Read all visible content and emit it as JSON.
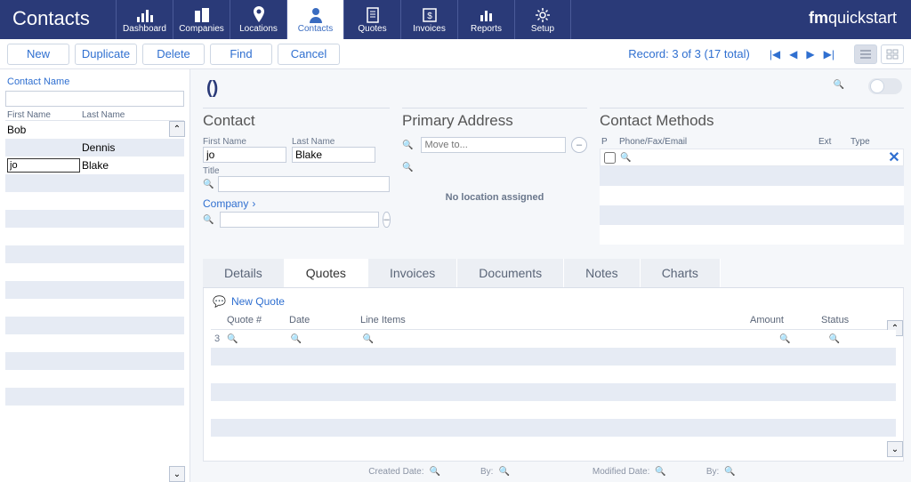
{
  "app": {
    "title": "Contacts"
  },
  "brand": {
    "bold": "fm",
    "light": "quickstart"
  },
  "nav": [
    {
      "id": "dashboard",
      "label": "Dashboard",
      "active": false
    },
    {
      "id": "companies",
      "label": "Companies",
      "active": false
    },
    {
      "id": "locations",
      "label": "Locations",
      "active": false
    },
    {
      "id": "contacts",
      "label": "Contacts",
      "active": true
    },
    {
      "id": "quotes",
      "label": "Quotes",
      "active": false
    },
    {
      "id": "invoices",
      "label": "Invoices",
      "active": false
    },
    {
      "id": "reports",
      "label": "Reports",
      "active": false
    },
    {
      "id": "setup",
      "label": "Setup",
      "active": false
    }
  ],
  "toolbar": {
    "new": "New",
    "duplicate": "Duplicate",
    "delete": "Delete",
    "find": "Find",
    "cancel": "Cancel"
  },
  "record_counter": "Record:  3 of 3 (17 total)",
  "left": {
    "filter_label": "Contact Name",
    "first_col": "First Name",
    "last_col": "Last Name",
    "rows": [
      {
        "first": "Bob",
        "last": ""
      },
      {
        "first": "",
        "last": "Dennis"
      },
      {
        "first": "jo",
        "last": "Blake",
        "editing": true
      }
    ]
  },
  "header_name": "()",
  "contact": {
    "title_label": "Contact",
    "first_label": "First Name",
    "first_value": "jo",
    "last_label": "Last Name",
    "last_value": "Blake",
    "title_field_label": "Title",
    "company_link": "Company"
  },
  "address": {
    "title": "Primary Address",
    "moveto_placeholder": "Move to...",
    "noloc": "No location assigned"
  },
  "methods": {
    "title": "Contact Methods",
    "col_p": "P",
    "col_pfe": "Phone/Fax/Email",
    "col_ext": "Ext",
    "col_type": "Type"
  },
  "tabs": {
    "details": "Details",
    "quotes": "Quotes",
    "invoices": "Invoices",
    "documents": "Documents",
    "notes": "Notes",
    "charts": "Charts",
    "active": "quotes"
  },
  "quotes": {
    "new_label": "New Quote",
    "cols": {
      "q": "Quote #",
      "d": "Date",
      "li": "Line Items",
      "a": "Amount",
      "s": "Status"
    },
    "row_count_label": "3"
  },
  "footer": {
    "created": "Created Date:",
    "by1": "By:",
    "modified": "Modified Date:",
    "by2": "By:"
  }
}
